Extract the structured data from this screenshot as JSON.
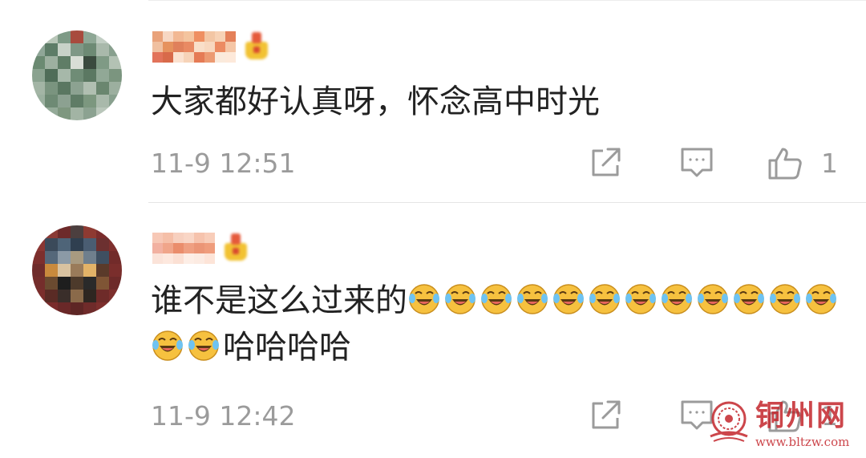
{
  "comments": [
    {
      "username": "",
      "text": "大家都好认真呀，怀念高中时光",
      "timestamp": "11-9 12:51",
      "like_count": "1",
      "emoji_count": 0,
      "trailing_text": ""
    },
    {
      "username": "",
      "text": "谁不是这么过来的",
      "timestamp": "11-9 12:42",
      "like_count": "1",
      "emoji": "laughing-crying-emoji",
      "emoji_count": 14,
      "trailing_text": "哈哈哈哈"
    }
  ],
  "icons": {
    "share": "share-icon",
    "reply": "comment-icon",
    "like": "thumbs-up-icon",
    "badge": "crown-badge-icon"
  },
  "watermark": {
    "title": "铜州网",
    "url": "www.bltzw.com"
  },
  "colors": {
    "text": "#222222",
    "meta": "#9b9b9b",
    "divider": "#e5e5e5",
    "emoji_face": "#f6c13f",
    "watermark": "#c4262c"
  }
}
